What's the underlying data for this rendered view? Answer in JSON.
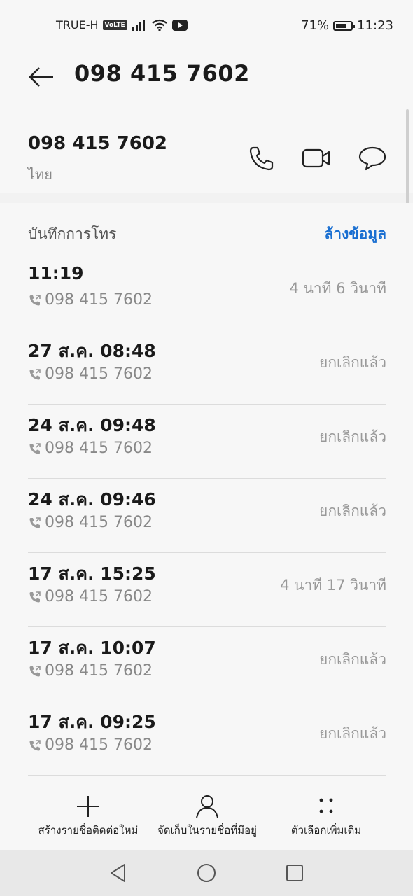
{
  "status_bar": {
    "carrier": "TRUE-H",
    "network_badge": "VoLTE",
    "battery": "71%",
    "battery_level": 0.71,
    "time": "11:23"
  },
  "header": {
    "title": "098 415 7602",
    "back_icon": "arrow-left-icon"
  },
  "contact": {
    "number": "098 415 7602",
    "region": "ไทย",
    "actions": [
      "phone-icon",
      "video-call-icon",
      "message-icon"
    ]
  },
  "call_log": {
    "title": "บันทึกการโทร",
    "clear_label": "ล้างข้อมูล",
    "entries": [
      {
        "time": "11:19",
        "number": "098 415 7602",
        "status": "4 นาที 6 วินาที"
      },
      {
        "time": "27 ส.ค. 08:48",
        "number": "098 415 7602",
        "status": "ยกเลิกแล้ว"
      },
      {
        "time": "24 ส.ค. 09:48",
        "number": "098 415 7602",
        "status": "ยกเลิกแล้ว"
      },
      {
        "time": "24 ส.ค. 09:46",
        "number": "098 415 7602",
        "status": "ยกเลิกแล้ว"
      },
      {
        "time": "17 ส.ค. 15:25",
        "number": "098 415 7602",
        "status": "4 นาที 17 วินาที"
      },
      {
        "time": "17 ส.ค. 10:07",
        "number": "098 415 7602",
        "status": "ยกเลิกแล้ว"
      },
      {
        "time": "17 ส.ค. 09:25",
        "number": "098 415 7602",
        "status": "ยกเลิกแล้ว"
      }
    ]
  },
  "bottom_bar": {
    "create": "สร้างรายชื่อติดต่อใหม่",
    "save_existing": "จัดเก็บในรายชื่อที่มีอยู่",
    "more": "ตัวเลือกเพิ่มเติม"
  },
  "colors": {
    "accent": "#1a6fd1",
    "background": "#f7f7f7"
  }
}
